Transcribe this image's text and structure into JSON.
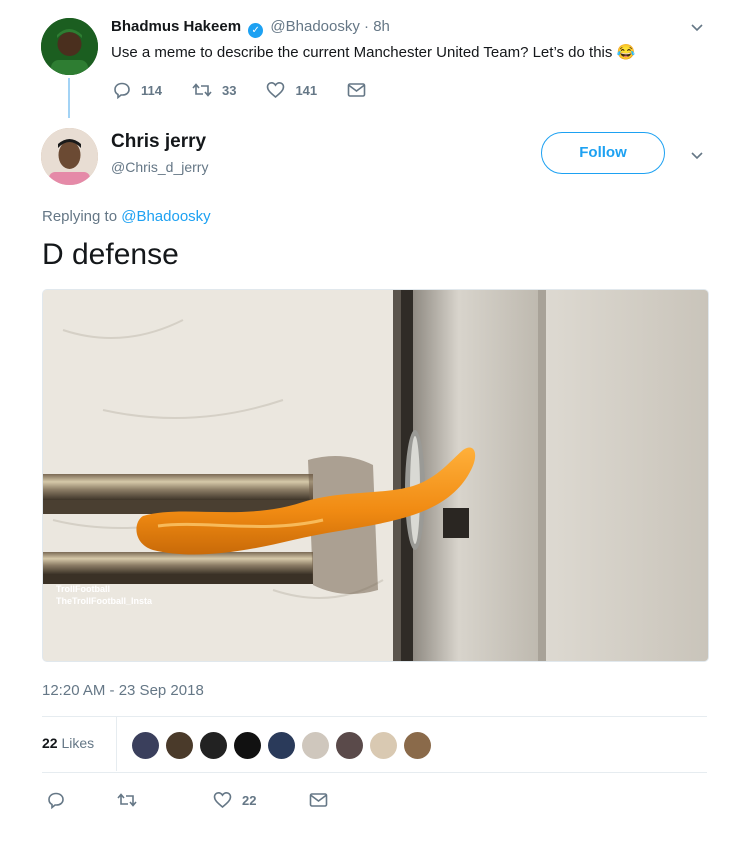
{
  "parent_tweet": {
    "author_name": "Bhadmus Hakeem",
    "handle": "@Bhadoosky",
    "separator": "·",
    "time": "8h",
    "text": "Use a meme to describe the current Manchester United Team? Let’s do this 😂",
    "actions": {
      "reply_count": "114",
      "retweet_count": "33",
      "like_count": "141"
    }
  },
  "reply_tweet": {
    "author_name": "Chris jerry",
    "handle": "@Chris_d_jerry",
    "follow_label": "Follow",
    "replying_prefix": "Replying to ",
    "replying_handle": "@Bhadoosky",
    "text": "D defense",
    "media": {
      "watermark_line1": "TrollFootball",
      "watermark_line2": "TheTrollFootball_Insta"
    },
    "timestamp": "12:20 AM - 23 Sep 2018",
    "likes_count": "22",
    "likes_label": " Likes",
    "likers": [
      "#3a3f5c",
      "#4a3a2a",
      "#222222",
      "#111111",
      "#2a3a5a",
      "#cfc7bd",
      "#5a4a4a",
      "#d9c9b2",
      "#8a6a4a"
    ],
    "footer_like_count": "22"
  },
  "colors": {
    "accent": "#1da1f2",
    "muted": "#657786",
    "text": "#14171a"
  }
}
